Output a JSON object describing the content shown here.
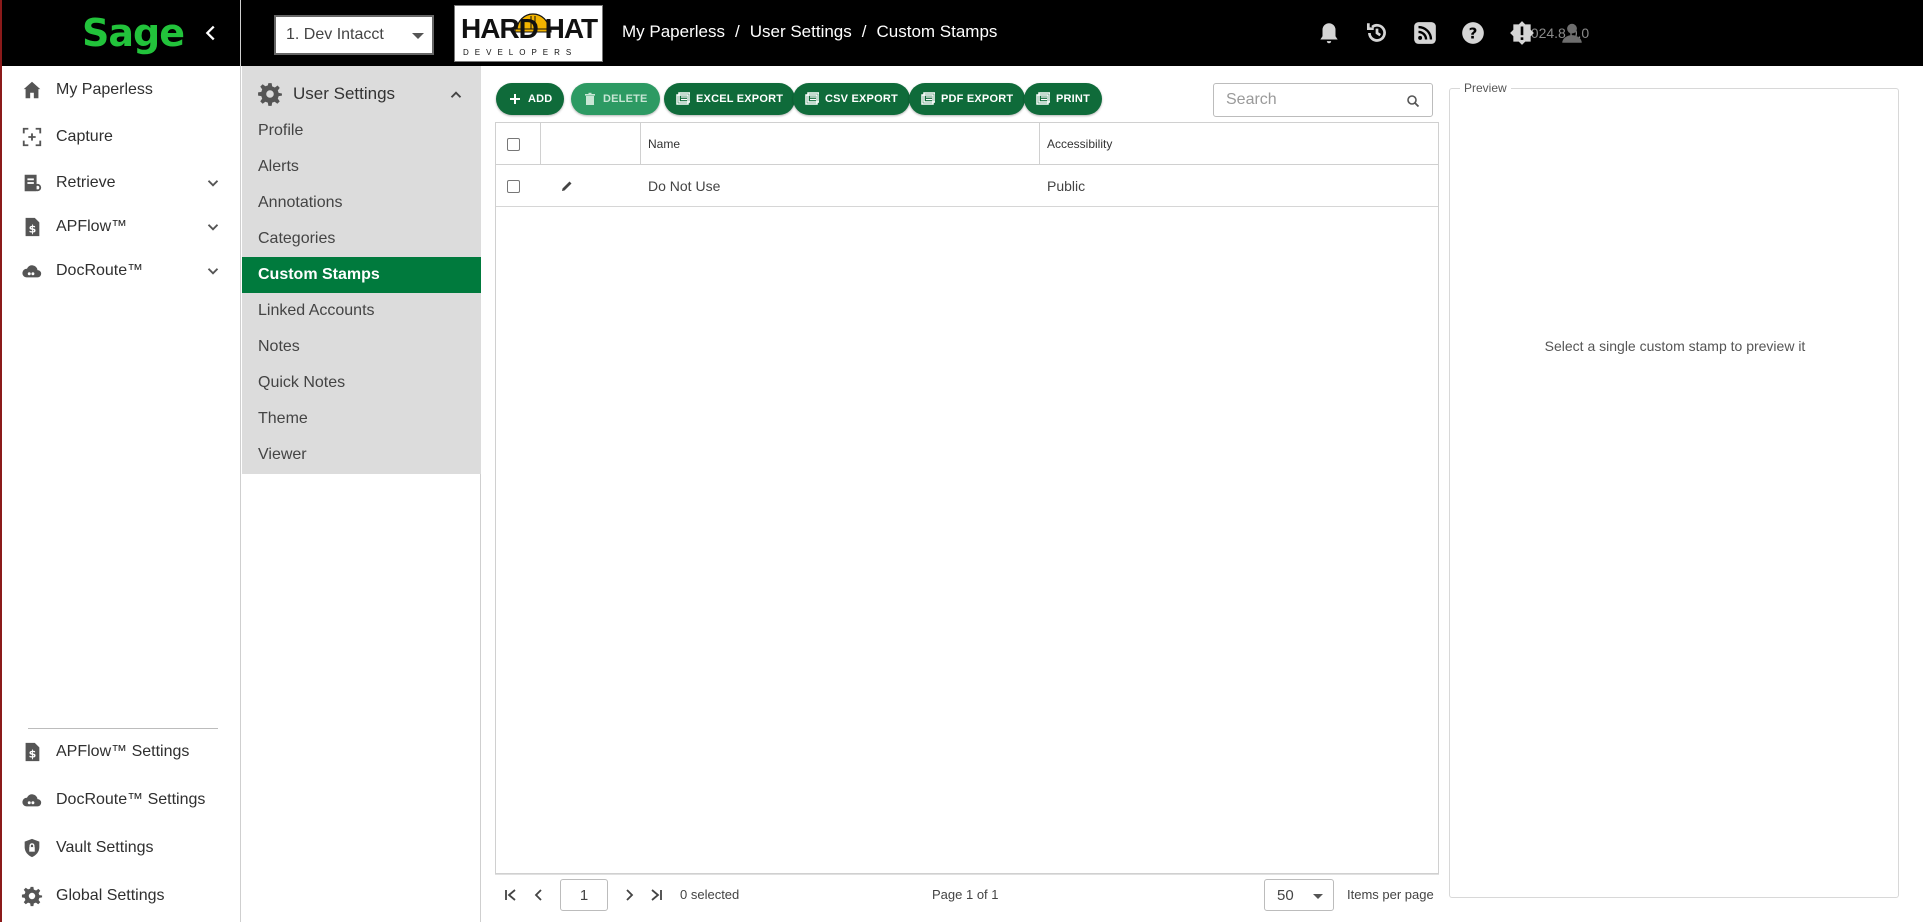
{
  "app": {
    "brand": "Sage",
    "version": "v2024.8.0.0"
  },
  "company_select": {
    "value": "1. Dev Intacct"
  },
  "org_logo": {
    "line1": "HARD HAT",
    "line2": "DEVELOPERS"
  },
  "breadcrumb": [
    "My Paperless",
    "User Settings",
    "Custom Stamps"
  ],
  "left_nav": {
    "items": [
      {
        "label": "My Paperless",
        "icon": "home-icon"
      },
      {
        "label": "Capture",
        "icon": "capture-icon"
      },
      {
        "label": "Retrieve",
        "icon": "retrieve-icon"
      },
      {
        "label": "APFlow™",
        "icon": "apflow-icon"
      },
      {
        "label": "DocRoute™",
        "icon": "docroute-icon"
      }
    ],
    "bottom_items": [
      {
        "label": "APFlow™ Settings",
        "icon": "apflow-icon"
      },
      {
        "label": "DocRoute™ Settings",
        "icon": "docroute-icon"
      },
      {
        "label": "Vault Settings",
        "icon": "shield-lock-icon"
      },
      {
        "label": "Global Settings",
        "icon": "gear-icon"
      }
    ]
  },
  "settings_nav": {
    "header": "User Settings",
    "items": [
      "Profile",
      "Alerts",
      "Annotations",
      "Categories",
      "Custom Stamps",
      "Linked Accounts",
      "Notes",
      "Quick Notes",
      "Theme",
      "Viewer"
    ],
    "active": "Custom Stamps"
  },
  "toolbar": {
    "add": "ADD",
    "delete": "DELETE",
    "excel": "EXCEL EXPORT",
    "csv": "CSV EXPORT",
    "pdf": "PDF EXPORT",
    "print": "PRINT"
  },
  "search": {
    "placeholder": "Search",
    "value": ""
  },
  "grid": {
    "columns": [
      "Name",
      "Accessibility"
    ],
    "rows": [
      {
        "name": "Do Not Use",
        "accessibility": "Public"
      }
    ]
  },
  "pager": {
    "page": "1",
    "selected": "0 selected",
    "page_info": "Page 1 of 1",
    "page_size": "50",
    "items_per_page": "Items per page"
  },
  "preview": {
    "title": "Preview",
    "message": "Select a single custom stamp to preview it"
  },
  "colors": {
    "accent": "#007a3d",
    "button": "#0f6b3a",
    "brand_green": "#22c33b",
    "topbar": "#000000"
  }
}
